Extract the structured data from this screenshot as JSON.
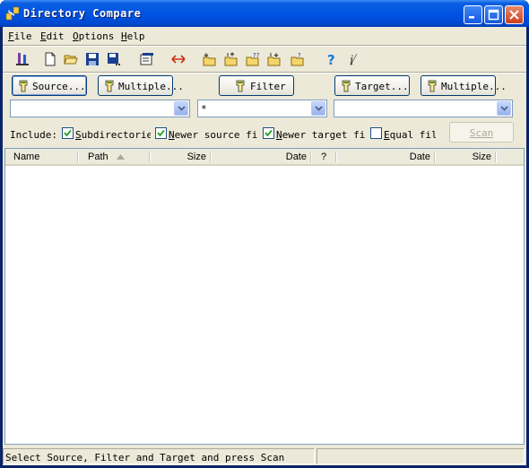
{
  "window": {
    "title": "Directory Compare"
  },
  "menu": [
    {
      "label": "File",
      "accel": "F",
      "rest": "ile"
    },
    {
      "label": "Edit",
      "accel": "E",
      "rest": "dit"
    },
    {
      "label": "Options",
      "accel": "O",
      "rest": "ptions"
    },
    {
      "label": "Help",
      "accel": "H",
      "rest": "elp"
    }
  ],
  "buttons": {
    "source": "Source...",
    "multiple_source": "Multiple...",
    "filter": "Filter",
    "target": "Target...",
    "multiple_target": "Multiple...",
    "scan": "Scan"
  },
  "combos": {
    "source_value": "",
    "filter_value": "*",
    "target_value": ""
  },
  "include": {
    "label": "Include:",
    "options": [
      {
        "accel": "S",
        "rest": "ubdirectories",
        "checked": true
      },
      {
        "accel": "N",
        "rest": "ewer source fil",
        "checked": true
      },
      {
        "accel": "N",
        "rest": "ewer target fil",
        "checked": true
      },
      {
        "accel": "E",
        "rest": "qual file",
        "checked": false
      }
    ]
  },
  "columns": [
    "Name",
    "Path",
    "Size",
    "Date",
    "?",
    "Date",
    "Size"
  ],
  "status": {
    "text": "Select Source, Filter and Target and press Scan"
  },
  "colors": {
    "accent": "#0054e3",
    "face": "#ece9d8",
    "border": "#7f9db9"
  }
}
